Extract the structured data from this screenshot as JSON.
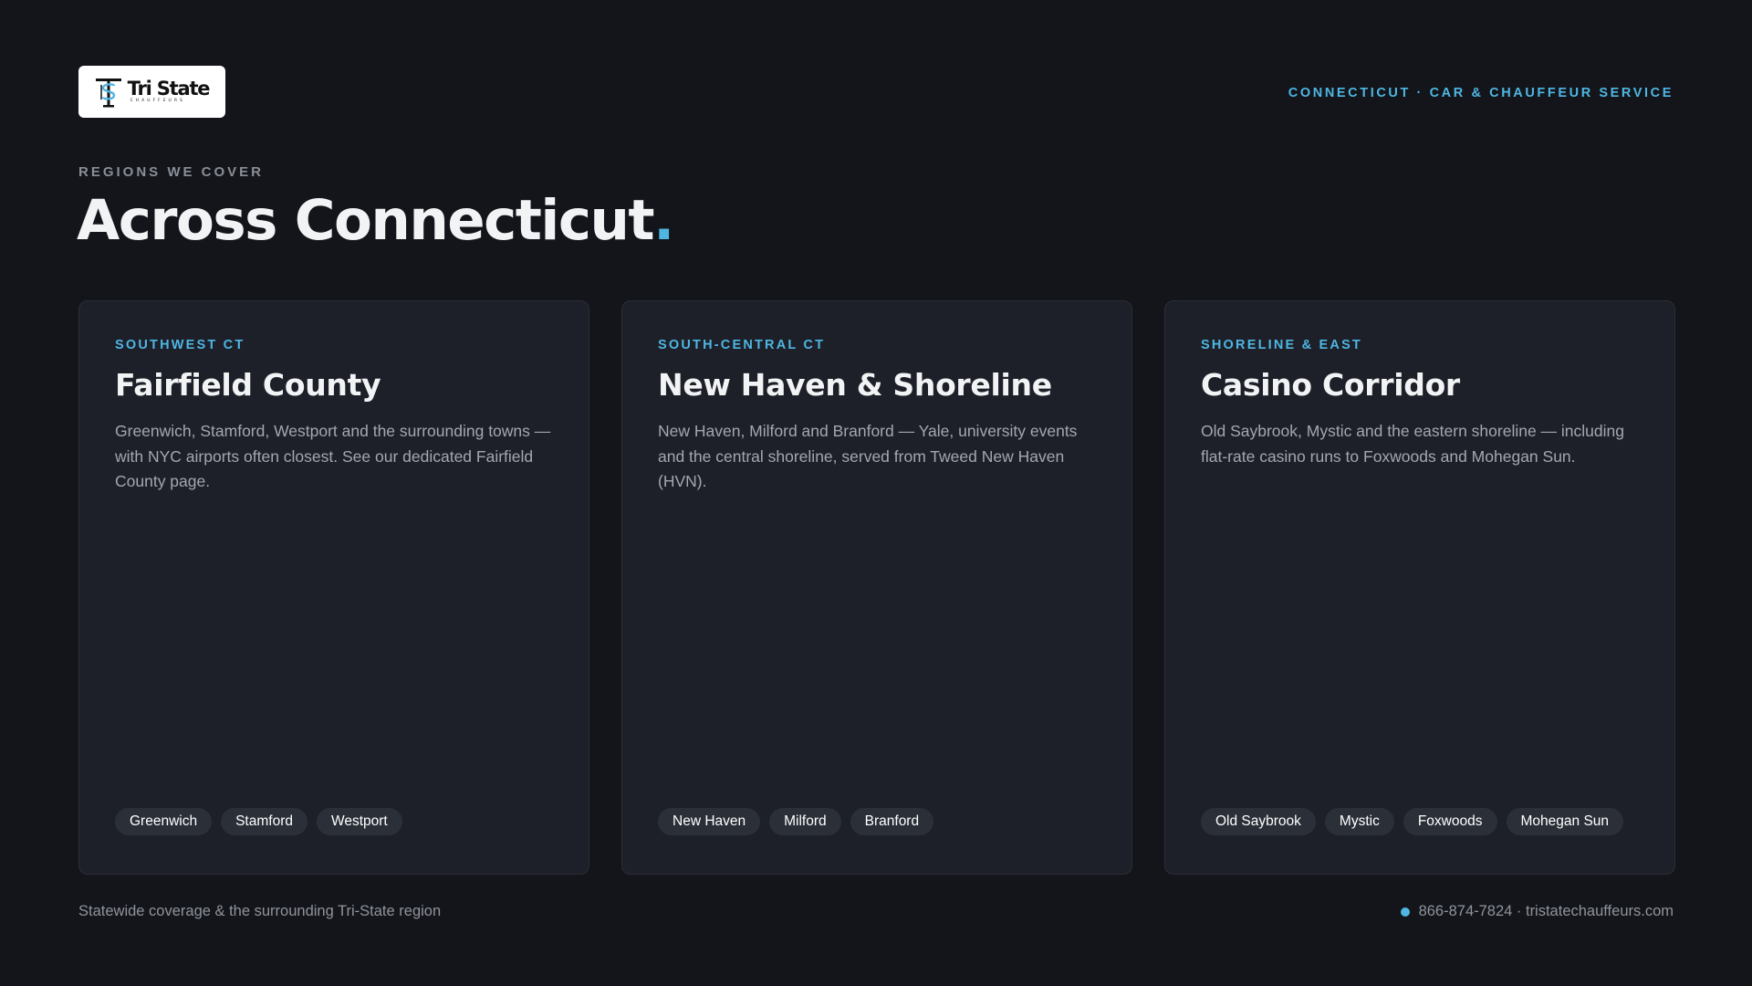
{
  "header": {
    "logo": {
      "name": "Tri State",
      "sub": "CHAUFFEURS"
    },
    "tagline": "CONNECTICUT · CAR & CHAUFFEUR SERVICE"
  },
  "intro": {
    "eyebrow": "REGIONS WE COVER",
    "title": "Across Connecticut",
    "title_punct": "."
  },
  "cards": [
    {
      "eyebrow": "SOUTHWEST CT",
      "title": "Fairfield County",
      "description": "Greenwich, Stamford, Westport and the surrounding towns — with NYC airports often closest. See our dedicated Fairfield County page.",
      "chips": [
        "Greenwich",
        "Stamford",
        "Westport"
      ]
    },
    {
      "eyebrow": "SOUTH-CENTRAL CT",
      "title": "New Haven & Shoreline",
      "description": "New Haven, Milford and Branford — Yale, university events and the central shoreline, served from Tweed New Haven (HVN).",
      "chips": [
        "New Haven",
        "Milford",
        "Branford"
      ]
    },
    {
      "eyebrow": "SHORELINE & EAST",
      "title": "Casino Corridor",
      "description": "Old Saybrook, Mystic and the eastern shoreline — including flat-rate casino runs to Foxwoods and Mohegan Sun.",
      "chips": [
        "Old Saybrook",
        "Mystic",
        "Foxwoods",
        "Mohegan Sun"
      ]
    }
  ],
  "footer": {
    "left": "Statewide coverage & the surrounding Tri-State region",
    "contact": "866-874-7824 · tristatechauffeurs.com"
  },
  "colors": {
    "accent": "#4fb6e3",
    "background": "#13151a",
    "card": "#1d2028"
  }
}
